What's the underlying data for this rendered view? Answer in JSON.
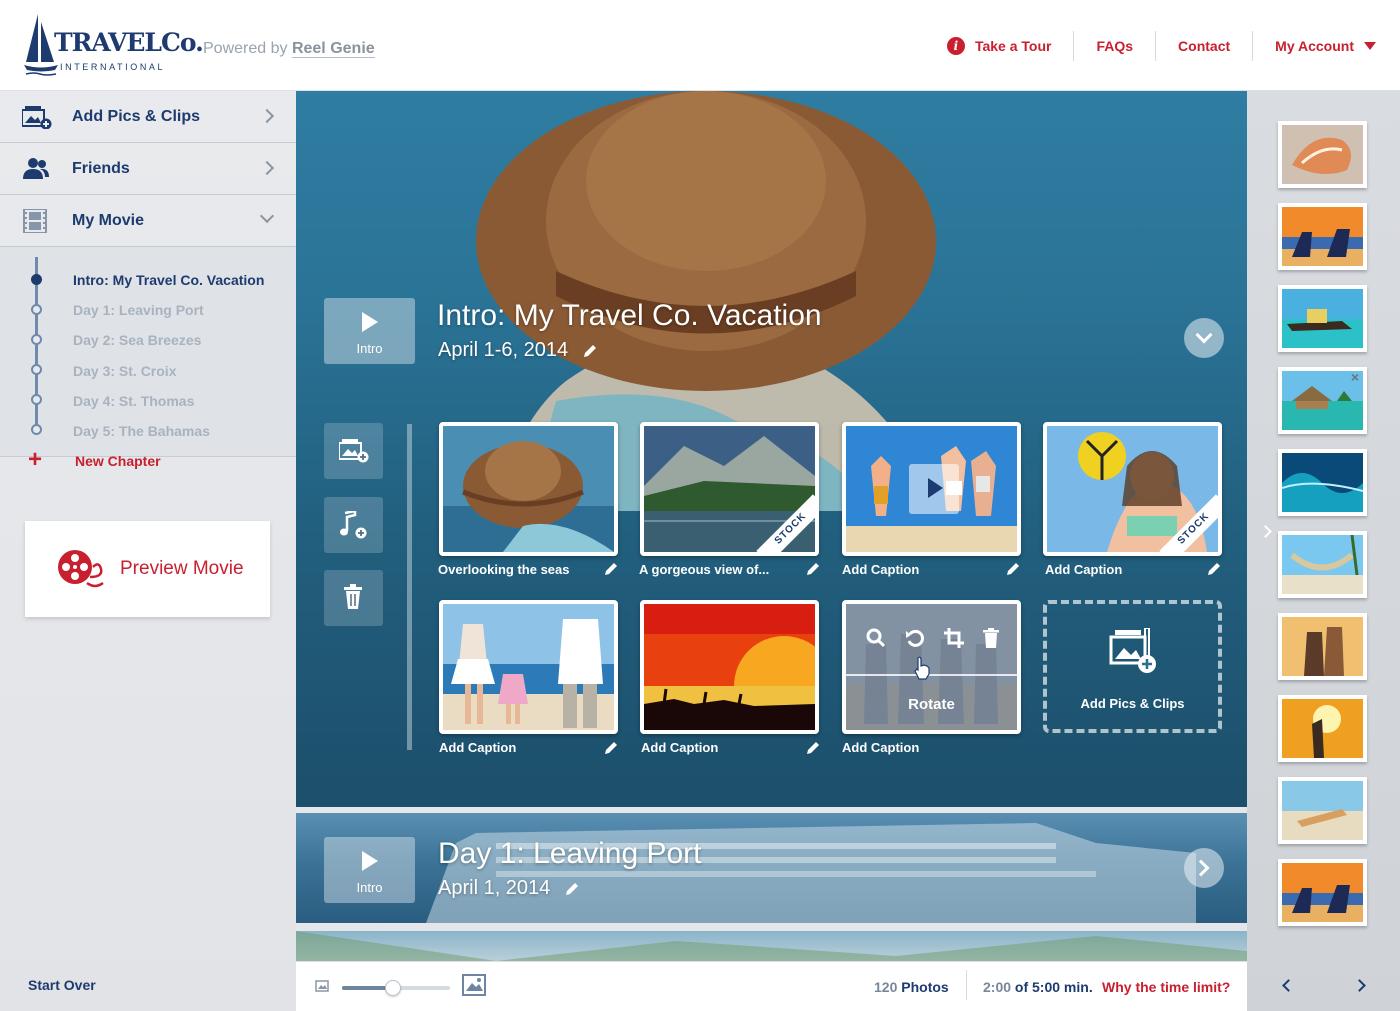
{
  "header": {
    "logo_word": "TRAVELCo.",
    "logo_sub": "INTERNATIONAL",
    "powered_prefix": "Powered by",
    "powered_brand": "Reel Genie",
    "nav": {
      "tour": "Take a Tour",
      "faqs": "FAQs",
      "contact": "Contact",
      "account": "My Account"
    }
  },
  "sidebar": {
    "add_pics": "Add Pics & Clips",
    "friends": "Friends",
    "my_movie": "My Movie",
    "chapters": [
      "Intro: My Travel Co. Vacation",
      "Day 1: Leaving Port",
      "Day 2: Sea Breezes",
      "Day 3: St. Croix",
      "Day 4: St. Thomas",
      "Day 5: The Bahamas"
    ],
    "new_chapter": "New Chapter",
    "preview_movie": "Preview Movie",
    "start_over": "Start Over"
  },
  "chapter1": {
    "play_label": "Intro",
    "title": "Intro: My Travel Co. Vacation",
    "date": "April 1-6, 2014",
    "captions": [
      "Overlooking the seas",
      "A gorgeous view of...",
      "Add Caption",
      "Add Caption",
      "Add Caption",
      "Add Caption",
      "Add Caption"
    ],
    "stock_label": "STOCK",
    "rotate_label": "Rotate",
    "add_tile_label": "Add Pics & Clips"
  },
  "chapter2": {
    "play_label": "Intro",
    "title": "Day 1: Leaving Port",
    "date": "April 1, 2014"
  },
  "bottombar": {
    "photo_count": "120",
    "photos_label": "Photos",
    "time_used": "2:00",
    "time_total": "of 5:00 min.",
    "time_link": "Why the time limit?",
    "zoom_level": 0.47
  },
  "colors": {
    "brand_navy": "#1d3b6e",
    "accent_red": "#c8202f"
  },
  "icons": {
    "gallery_close": "×"
  }
}
